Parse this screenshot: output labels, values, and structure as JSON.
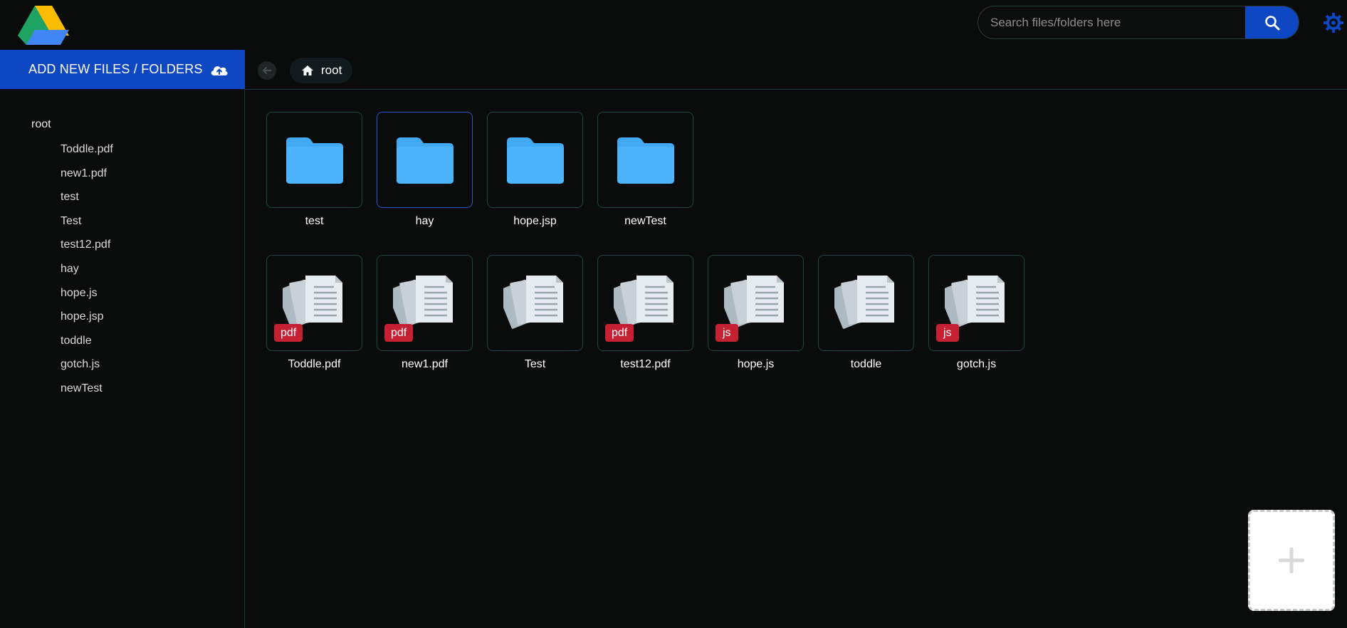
{
  "header": {
    "logo": "google-drive-logo",
    "search": {
      "placeholder": "Search files/folders here",
      "value": ""
    },
    "search_icon": "search-icon",
    "settings_icon": "gear-icon",
    "accent_color": "#0d47c1"
  },
  "sidebar": {
    "add_button_label": "ADD NEW FILES / FOLDERS",
    "add_button_icon": "cloud-upload-icon",
    "tree_root": "root",
    "tree_items": [
      "Toddle.pdf",
      "new1.pdf",
      "test",
      "Test",
      "test12.pdf",
      "hay",
      "hope.js",
      "hope.jsp",
      "toddle",
      "gotch.js",
      "newTest"
    ]
  },
  "breadcrumb": {
    "back_icon": "arrow-left-icon",
    "home_icon": "home-icon",
    "current": "root"
  },
  "folders": [
    {
      "name": "test"
    },
    {
      "name": "hay"
    },
    {
      "name": "hope.jsp"
    },
    {
      "name": "newTest"
    }
  ],
  "files": [
    {
      "name": "Toddle.pdf",
      "badge": "pdf"
    },
    {
      "name": "new1.pdf",
      "badge": "pdf"
    },
    {
      "name": "Test",
      "badge": ""
    },
    {
      "name": "test12.pdf",
      "badge": "pdf"
    },
    {
      "name": "hope.js",
      "badge": "js"
    },
    {
      "name": "toddle",
      "badge": ""
    },
    {
      "name": "gotch.js",
      "badge": "js"
    }
  ],
  "dropzone": {
    "icon": "plus-icon"
  },
  "colors": {
    "folder": "#42aaf5",
    "badge": "#c62132",
    "tile_border": "#1a4644"
  }
}
